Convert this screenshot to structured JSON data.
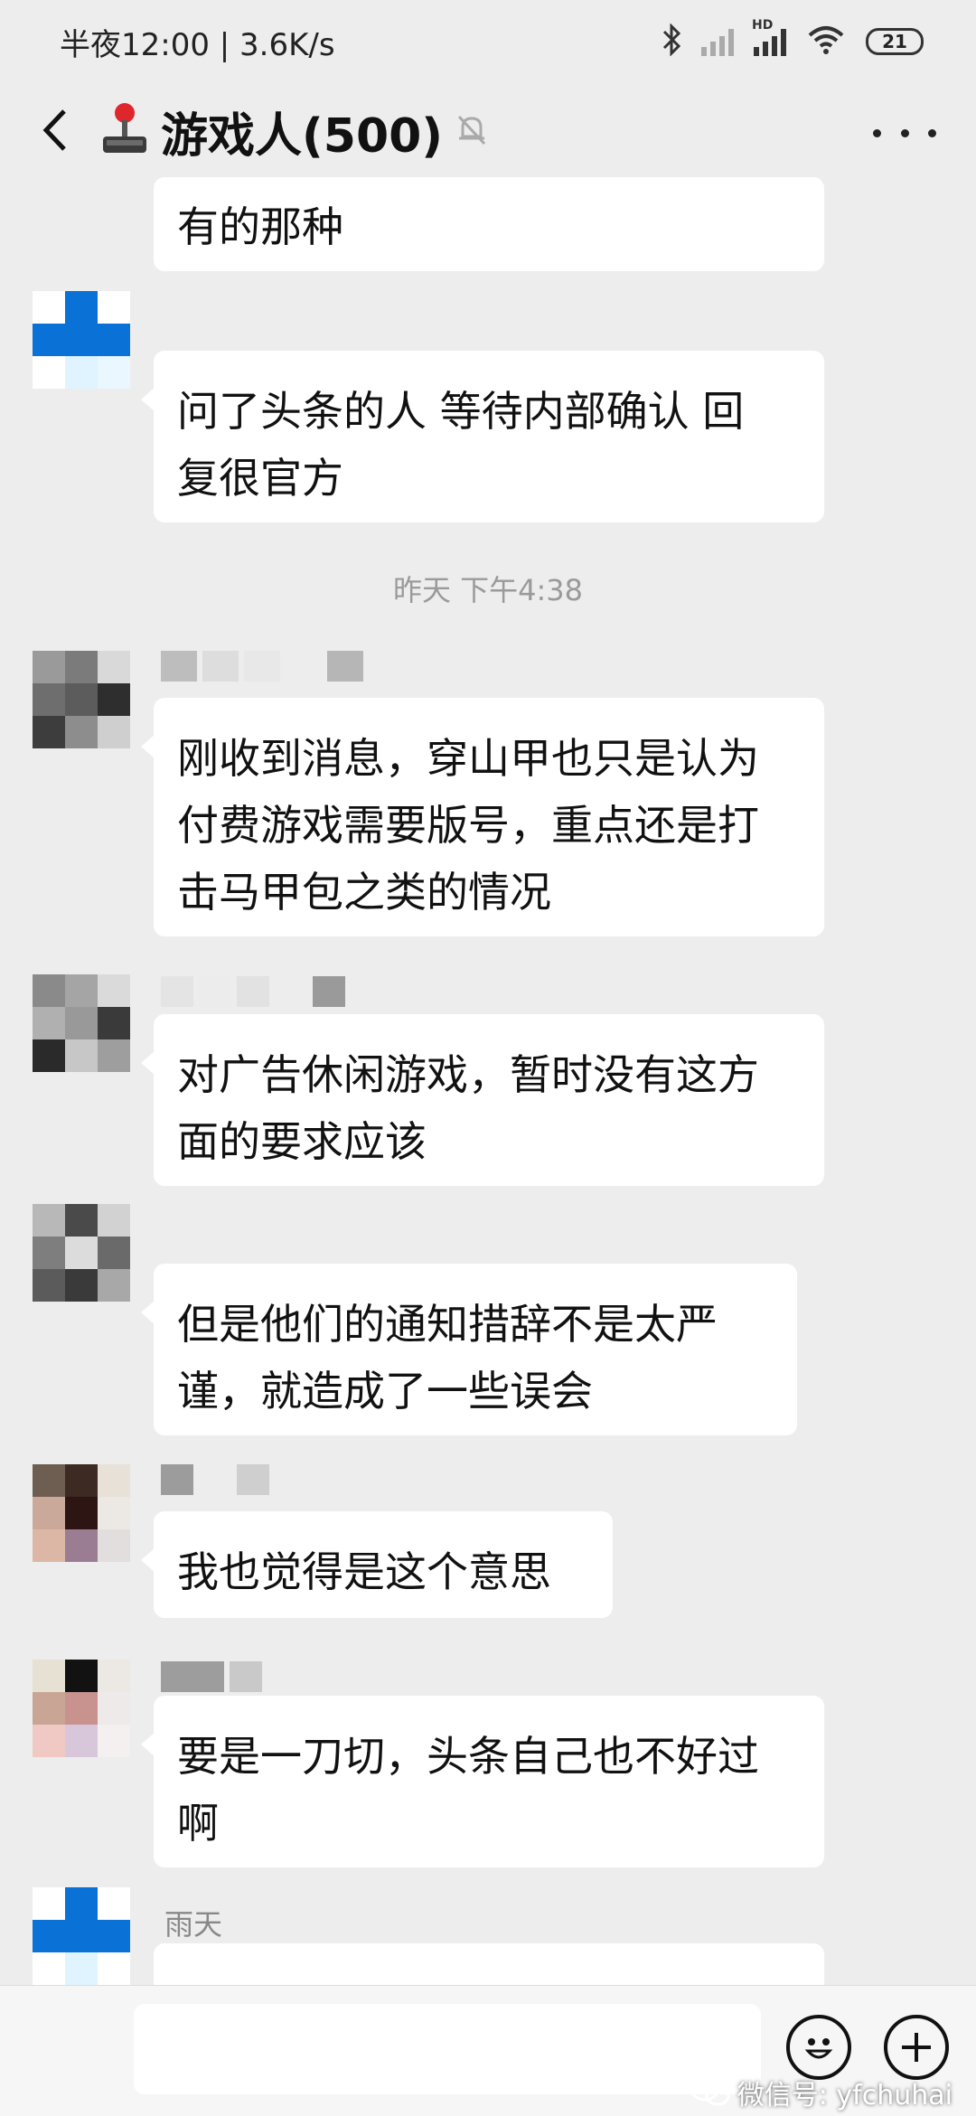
{
  "status_bar": {
    "time_speed": "半夜12:00 | 3.6K/s",
    "battery": "21",
    "hd_label": "HD"
  },
  "header": {
    "title": "游戏人(500)",
    "title_icon": "joystick-icon",
    "mute_icon": "bell-off-icon",
    "more_icon": "more-icon"
  },
  "messages": [
    {
      "text": "有的那种"
    },
    {
      "text": "问了头条的人 等待内部确认 回\n复很官方"
    },
    {
      "text": "刚收到消息，穿山甲也只是认为\n付费游戏需要版号，重点还是打\n击马甲包之类的情况"
    },
    {
      "text": "对广告休闲游戏，暂时没有这方\n面的要求应该"
    },
    {
      "text": "但是他们的通知措辞不是太严\n谨，就造成了一些误会"
    },
    {
      "text": "我也觉得是这个意思"
    },
    {
      "text": "要是一刀切，头条自己也不好过\n啊"
    }
  ],
  "timestamp": "昨天 下午4:38",
  "last_sender": "雨天",
  "input_bar": {
    "emoji_icon": "emoji-icon",
    "add_icon": "plus-circle-icon",
    "watermark": "微信号: yfchuhai"
  },
  "colors": {
    "background": "#ededed",
    "bubble": "#ffffff",
    "avatar_blue": "#0a72d6"
  }
}
